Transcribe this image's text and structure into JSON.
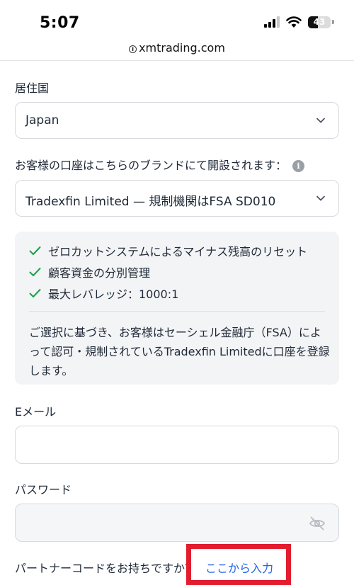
{
  "status_bar": {
    "time": "5:07",
    "battery": "43",
    "icons": [
      "signal-icon",
      "wifi-icon",
      "battery-icon"
    ]
  },
  "browser": {
    "url": "xmtrading.com",
    "url_icon": "info-icon"
  },
  "form": {
    "country": {
      "label": "居住国",
      "value": "Japan"
    },
    "brand": {
      "label": "お客様の口座はこちらのブランドにて開設されます：",
      "value": "Tradexfin Limited — 規制機関はFSA SD010"
    },
    "features": [
      "ゼロカットシステムによるマイナス残高のリセット",
      "顧客資金の分別管理",
      "最大レバレッジ：1000:1"
    ],
    "note": "ご選択に基づき、お客様はセーシェル金融庁（FSA）によって認可・規制されているTradexfin Limitedに口座を登録します。",
    "email": {
      "label": "Eメール",
      "value": "",
      "placeholder": ""
    },
    "password": {
      "label": "パスワード",
      "value": "",
      "placeholder": ""
    },
    "partner": {
      "question": "パートナーコードをお持ちですか？",
      "link": "ここから入力"
    }
  },
  "colors": {
    "link": "#2563eb",
    "check": "#16a34a",
    "highlight": "#e11d2e",
    "panel_bg": "#f3f4f6"
  }
}
